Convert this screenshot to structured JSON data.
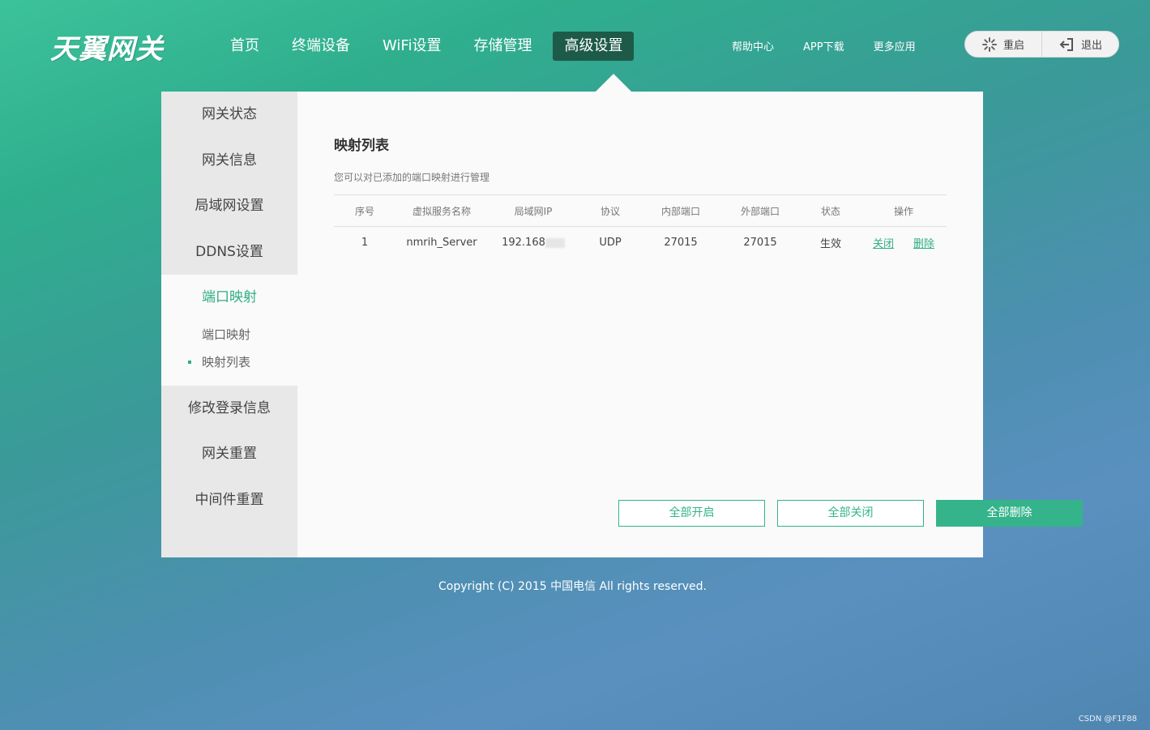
{
  "header": {
    "logo": "天翼网关",
    "nav": [
      "首页",
      "终端设备",
      "WiFi设置",
      "存储管理",
      "高级设置"
    ],
    "links": [
      "帮助中心",
      "APP下载",
      "更多应用"
    ],
    "restart_label": "重启",
    "logout_label": "退出"
  },
  "sidebar": {
    "items_top": [
      "网关状态",
      "网关信息",
      "局域网设置",
      "DDNS设置"
    ],
    "group_title": "端口映射",
    "sub_items": [
      "端口映射",
      "映射列表"
    ],
    "items_bottom": [
      "修改登录信息",
      "网关重置",
      "中间件重置"
    ]
  },
  "main": {
    "title": "映射列表",
    "description": "您可以对已添加的端口映射进行管理",
    "columns": [
      "序号",
      "虚拟服务名称",
      "局域网IP",
      "协议",
      "内部端口",
      "外部端口",
      "状态",
      "操作"
    ],
    "rows": [
      {
        "index": "1",
        "name": "nmrih_Server",
        "ip": "192.168",
        "protocol": "UDP",
        "internal_port": "27015",
        "external_port": "27015",
        "status": "生效",
        "op_close": "关闭",
        "op_delete": "删除"
      }
    ],
    "buttons": {
      "enable_all": "全部开启",
      "disable_all": "全部关闭",
      "delete_all": "全部删除"
    }
  },
  "footer": "Copyright (C) 2015 中国电信 All rights reserved.",
  "watermark": "CSDN @F1F88",
  "colors": {
    "accent": "#35b38a",
    "nav_active": "#1e5a48"
  }
}
